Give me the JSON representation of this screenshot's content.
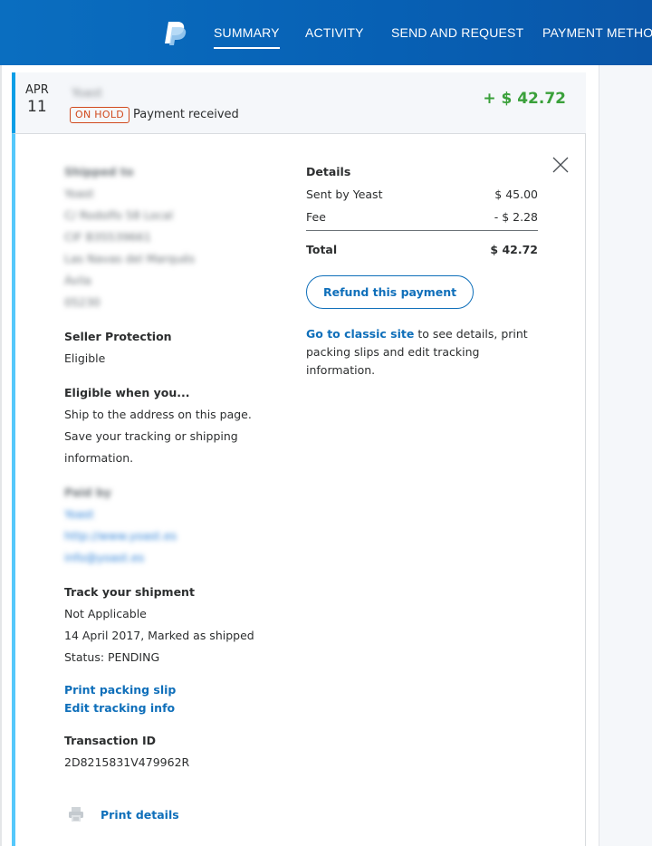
{
  "nav": {
    "logo": "paypal-logo",
    "items": [
      {
        "label": "SUMMARY",
        "active": true
      },
      {
        "label": "ACTIVITY",
        "active": false
      },
      {
        "label": "SEND AND REQUEST",
        "active": false
      },
      {
        "label": "PAYMENT METHODS",
        "active": false
      }
    ]
  },
  "transaction": {
    "month": "APR",
    "day": "11",
    "merchant": "Yoast",
    "badge": "ON HOLD",
    "status": "Payment received",
    "amount": "+ $ 42.72",
    "amount_color": "#3aa03a",
    "badge_color": "#d14a1e",
    "accent_color": "#0b9ee6"
  },
  "shipping": {
    "heading": "Shipped to",
    "lines": [
      "Yoast",
      "C/ Rodolfo 58 Local",
      "CIF B35539661",
      "Las Navas del Marqués",
      "Ávila",
      "05230"
    ]
  },
  "seller_protection": {
    "heading": "Seller Protection",
    "value": "Eligible"
  },
  "eligible_when": {
    "heading": "Eligible when you...",
    "lines": [
      "Ship to the address on this page.",
      "Save your tracking or shipping",
      "information."
    ]
  },
  "paid_by": {
    "heading": "Paid by",
    "name": "Yoast",
    "website": "http://www.yoast.es",
    "email": "info@yoast.es"
  },
  "tracking": {
    "heading": "Track your shipment",
    "lines": [
      "Not Applicable",
      "14 April 2017, Marked as shipped",
      "Status: PENDING"
    ],
    "print_slip": "Print packing slip",
    "edit_tracking": "Edit tracking info"
  },
  "transaction_id": {
    "heading": "Transaction ID",
    "value": "2D8215831V479962R"
  },
  "print_details": "Print details",
  "details": {
    "heading": "Details",
    "rows": [
      {
        "label": "Sent by Yeast",
        "value": "$ 45.00"
      },
      {
        "label": "Fee",
        "value": "- $ 2.28"
      }
    ],
    "total_label": "Total",
    "total_value": "$ 42.72",
    "refund_button": "Refund this payment",
    "classic_link": "Go to classic site",
    "classic_text": " to see details, print packing slips and edit tracking information."
  }
}
